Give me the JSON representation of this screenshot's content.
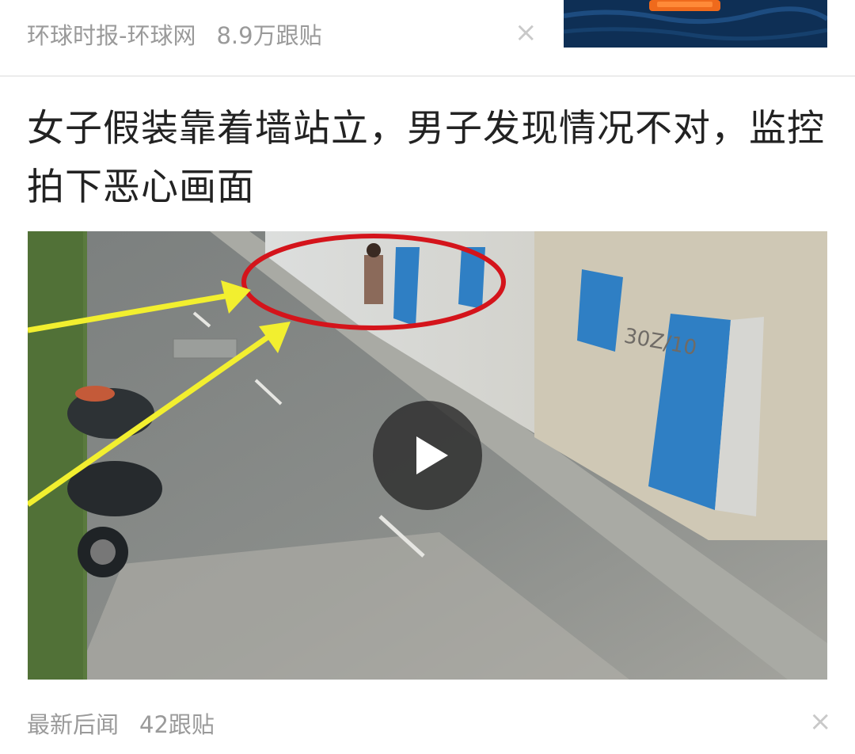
{
  "top_card": {
    "source": "环球时报-环球网",
    "comments": "8.9万跟贴",
    "close_glyph": "×"
  },
  "article": {
    "title": "女子假装靠着墙站立，男子发现情况不对，监控拍下恶心画面",
    "meta_source": "最新后闻",
    "meta_comments": "42跟贴",
    "close_glyph": "×"
  },
  "video": {
    "overlay_label": "30Z/10",
    "play_icon": "play-icon",
    "annotation_colors": {
      "circle": "#d4141b",
      "arrow": "#f2ef2f",
      "door": "#2f7fc4"
    }
  }
}
